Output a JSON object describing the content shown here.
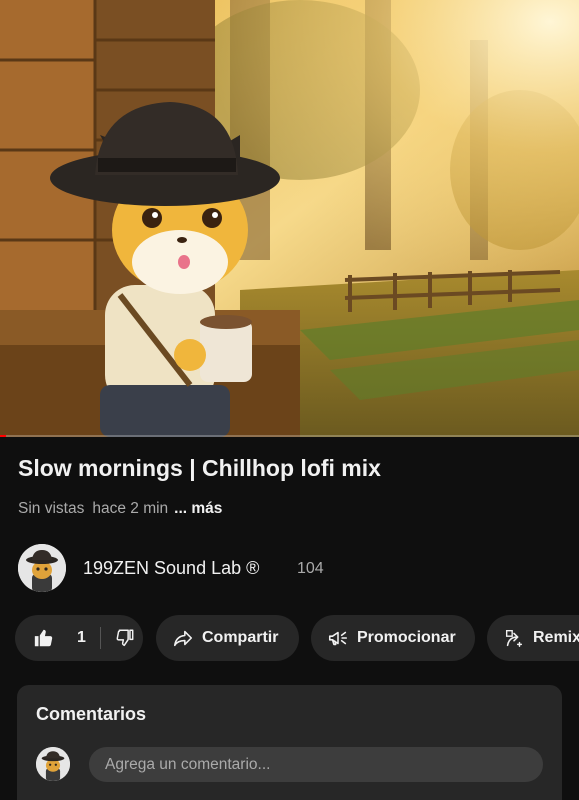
{
  "video": {
    "title": "Slow mornings | Chillhop lofi mix",
    "views": "Sin vistas",
    "age": "hace 2 min",
    "more_label": "... más",
    "progress_fraction": 0.01
  },
  "channel": {
    "name": "199ZEN Sound Lab ®",
    "subscriber_count": "104",
    "avatar_icon": "cat-cowboy-avatar"
  },
  "actions": {
    "like_count": "1",
    "like_icon": "thumbs-up-icon",
    "dislike_icon": "thumbs-down-icon",
    "share_label": "Compartir",
    "share_icon": "share-arrow-icon",
    "promote_label": "Promocionar",
    "promote_icon": "megaphone-icon",
    "remix_label": "Remix",
    "remix_icon": "remix-icon"
  },
  "comments": {
    "title": "Comentarios",
    "placeholder": "Agrega un comentario..."
  },
  "colors": {
    "background": "#0f0f0f",
    "surface": "#272727",
    "text_primary": "#f1f1f1",
    "text_secondary": "#aaaaaa",
    "progress": "#ff0000"
  }
}
